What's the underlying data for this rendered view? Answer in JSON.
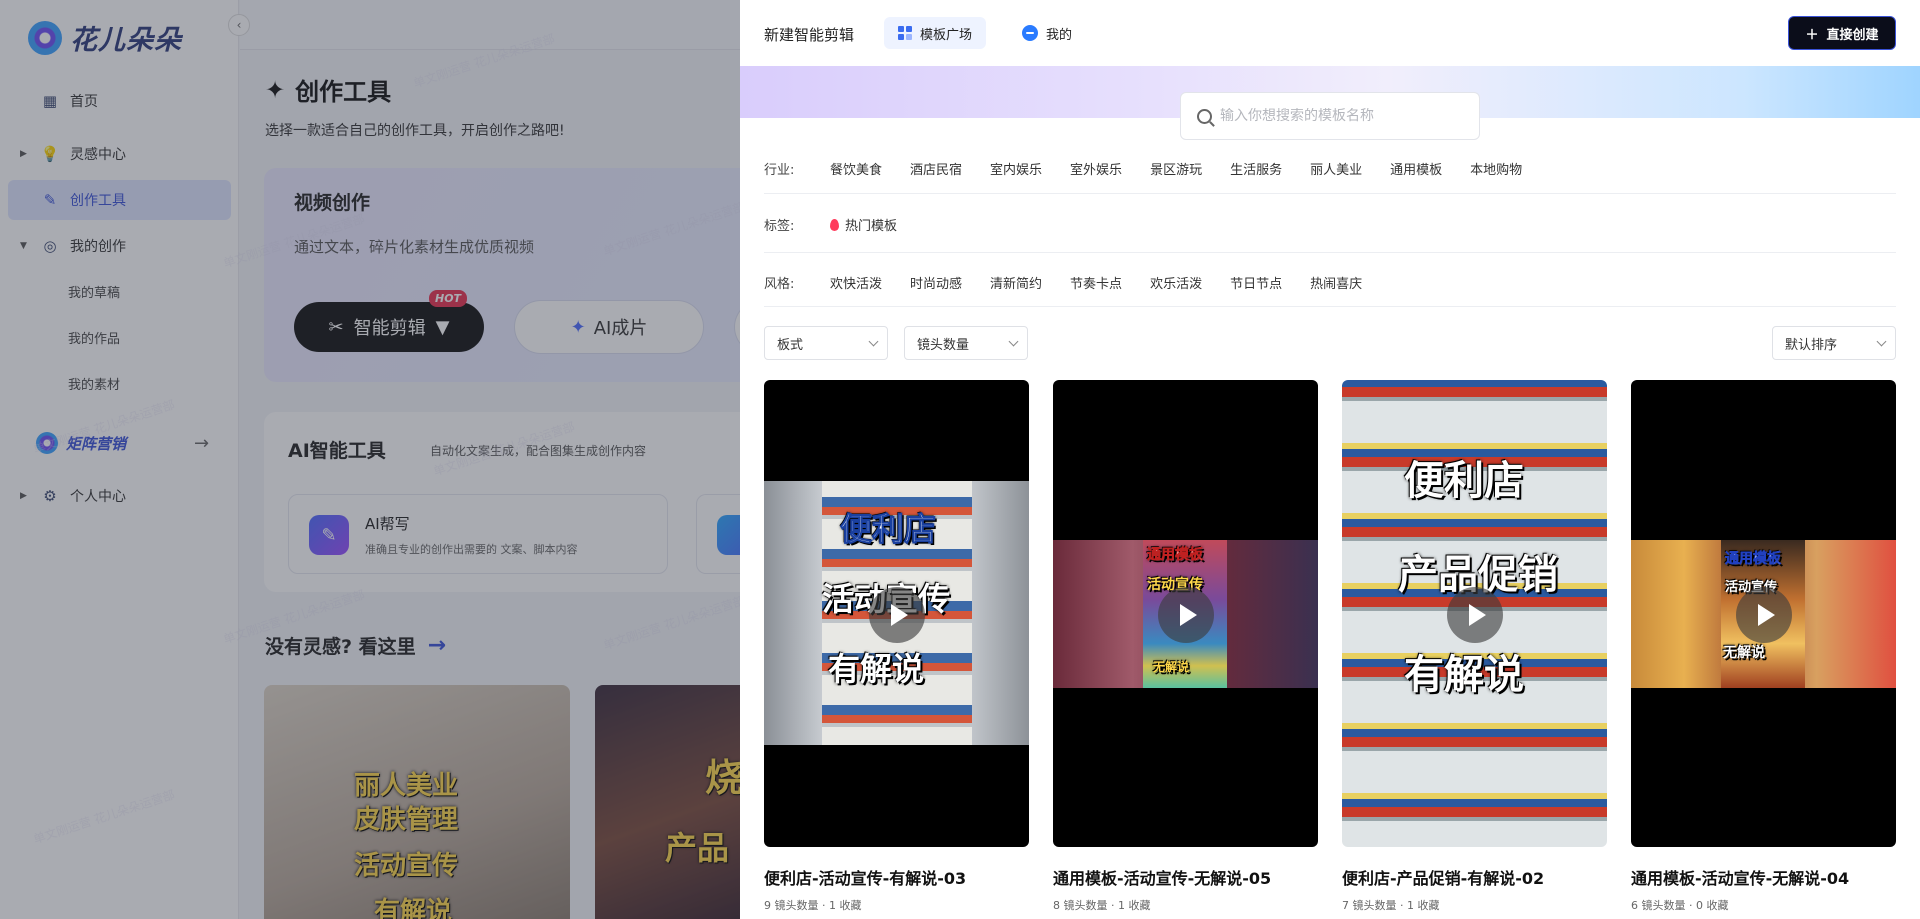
{
  "sidebar": {
    "logo_text": "花儿朵朵",
    "items": [
      {
        "label": "首页",
        "icon": "grid-icon"
      },
      {
        "label": "灵感中心",
        "icon": "lightbulb-icon"
      },
      {
        "label": "创作工具",
        "icon": "pen-icon"
      },
      {
        "label": "我的创作",
        "icon": "orbit-icon"
      }
    ],
    "sub_items": [
      "我的草稿",
      "我的作品",
      "我的素材"
    ],
    "matrix_label": "矩阵营销",
    "personal_label": "个人中心"
  },
  "main": {
    "title": "创作工具",
    "subtitle": "选择一款适合自己的创作工具，开启创作之路吧!",
    "video_card": {
      "title": "视频创作",
      "desc": "通过文本，碎片化素材生成优质视频",
      "btn_smart": "智能剪辑",
      "hot_badge": "HOT",
      "btn_ai": "AI成片"
    },
    "tools_card": {
      "title": "AI智能工具",
      "subtitle": "自动化文案生成，配合图集生成创作内容",
      "tool_name": "AI帮写",
      "tool_desc": "准确且专业的创作出需要的 文案、脚本内容"
    },
    "inspire_title": "没有灵感? 看这里",
    "inspire_a_text": [
      "丽人美业",
      "皮肤管理",
      "活动宣传",
      "有解说"
    ],
    "inspire_b_text": [
      "烧",
      "产品"
    ]
  },
  "drawer": {
    "title": "新建智能剪辑",
    "tabs": [
      {
        "label": "模板广场",
        "active": true
      },
      {
        "label": "我的",
        "active": false
      }
    ],
    "create_button": "直接创建",
    "search_placeholder": "输入你想搜索的模板名称",
    "filters": {
      "industry_label": "行业:",
      "industry_options": [
        "餐饮美食",
        "酒店民宿",
        "室内娱乐",
        "室外娱乐",
        "景区游玩",
        "生活服务",
        "丽人美业",
        "通用模板",
        "本地购物"
      ],
      "tag_label": "标签:",
      "tag_options": [
        "热门模板"
      ],
      "style_label": "风格:",
      "style_options": [
        "欢快活泼",
        "时尚动感",
        "清新简约",
        "节奏卡点",
        "欢乐活泼",
        "节日节点",
        "热闹喜庆"
      ]
    },
    "selects": {
      "format": "板式",
      "shot_count": "镜头数量",
      "sort": "默认排序"
    },
    "cards": [
      {
        "title": "便利店-活动宣传-有解说-03",
        "meta": "9 镜头数量 · 1 收藏",
        "caption": [
          "便利店",
          "活动宣传",
          "有解说"
        ]
      },
      {
        "title": "通用模板-活动宣传-无解说-05",
        "meta": "8 镜头数量 · 1 收藏",
        "caption": [
          "通用模板",
          "活动宣传",
          "无解说"
        ]
      },
      {
        "title": "便利店-产品促销-有解说-02",
        "meta": "7 镜头数量 · 1 收藏",
        "caption": [
          "便利店",
          "产品促销",
          "有解说"
        ]
      },
      {
        "title": "通用模板-活动宣传-无解说-04",
        "meta": "6 镜头数量 · 0 收藏",
        "caption": [
          "通用模板",
          "活动宣传",
          "无解说"
        ]
      }
    ]
  },
  "watermark": "单文刚运营 花儿朵朵运营部",
  "colors": {
    "accent": "#3a52d8",
    "hot": "#e8304f",
    "dark_button": "#0b0d1a"
  }
}
